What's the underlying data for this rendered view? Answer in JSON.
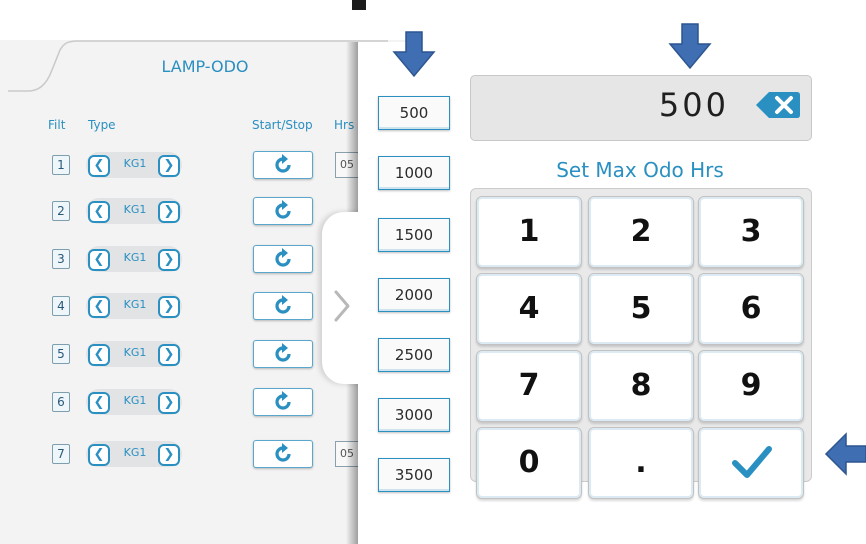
{
  "background_panel": {
    "title": "LAMP-ODO",
    "headers": {
      "filt": "Filt",
      "type": "Type",
      "start_stop": "Start/Stop",
      "hrs": "Hrs"
    },
    "rows": [
      {
        "filt": "1",
        "type": "KG1",
        "hrs": "05"
      },
      {
        "filt": "2",
        "type": "KG1",
        "hrs": ""
      },
      {
        "filt": "3",
        "type": "KG1",
        "hrs": ""
      },
      {
        "filt": "4",
        "type": "KG1",
        "hrs": ""
      },
      {
        "filt": "5",
        "type": "KG1",
        "hrs": ""
      },
      {
        "filt": "6",
        "type": "KG1",
        "hrs": ""
      },
      {
        "filt": "7",
        "type": "KG1",
        "hrs": "05"
      }
    ]
  },
  "presets": [
    "500",
    "1000",
    "1500",
    "2000",
    "2500",
    "3000",
    "3500"
  ],
  "display": {
    "value": "500"
  },
  "label": "Set Max Odo Hrs",
  "keypad": {
    "keys": [
      "1",
      "2",
      "3",
      "4",
      "5",
      "6",
      "7",
      "8",
      "9",
      "0",
      ".",
      "✓"
    ]
  },
  "icons": {
    "backspace": "backspace-icon",
    "confirm": "check-icon",
    "start_stop": "refresh-icon",
    "prev": "chevron-left-icon",
    "next": "chevron-right-icon",
    "annotation": "arrow-icon"
  },
  "colors": {
    "accent": "#2a8fc1",
    "annotation_arrow": "#3f6fb2"
  }
}
